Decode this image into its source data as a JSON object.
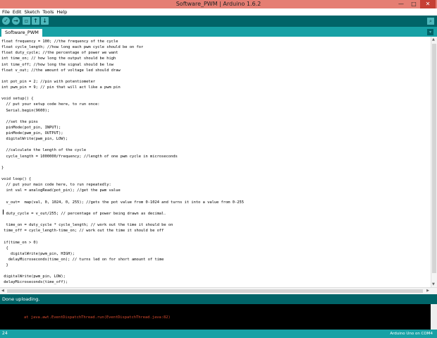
{
  "window": {
    "title": "Software_PWM | Arduino 1.6.2",
    "minimize": "—",
    "maximize": "□",
    "close": "✕"
  },
  "menu": [
    "File",
    "Edit",
    "Sketch",
    "Tools",
    "Help"
  ],
  "toolbar": {
    "verify_icon": "check-icon",
    "upload_icon": "arrow-right-icon",
    "new_icon": "new-file-icon",
    "open_icon": "arrow-up-icon",
    "save_icon": "arrow-down-icon",
    "serial_monitor_icon": "magnifier-icon"
  },
  "tabs": [
    {
      "label": "Software_PWM"
    }
  ],
  "code": [
    "float frequency = 100; //the frequency of the cycle",
    "float cycle_length; //how long each pwm cycle should be on for",
    "float duty_cycle; //the percentage of power we want",
    "int time_on; // how long the output should be high",
    "int time_off; //how long the signal should be low",
    "float v_out; //the amount of voltage led should draw",
    "",
    "int pot_pin = 2; //pin with potentiometer",
    "int pwm_pin = 9; // pin that will act like a pwm pin",
    "",
    "void setup() {",
    "  // put your setup code here, to run once:",
    "  Serial.begin(9600);",
    "",
    "  //set the pins",
    "  pinMode(pot_pin, INPUT);",
    "  pinMode(pwm_pin, OUTPUT);",
    "  digitalWrite(pwm_pin, LOW);",
    "",
    "  //calculate the length of the cycle",
    "  cycle_length = 1000000/frequency; //length of one pwm cycle in microseconds",
    "",
    "}",
    "",
    "void loop() {",
    "  // put your main code here, to run repeatedly:",
    "  int val = analogRead(pot_pin); //get the pwm value",
    "",
    "  v_out=  map(val, 0, 1024, 0, 255); //gets the pot value from 0-1024 and turns it into a value from 0-255",
    "",
    "  duty_cycle = v_out/255; // percentage of power being drawn as decimal.",
    "",
    "  time_on = duty_cycle * cycle_length; // work out the time it should be on",
    " time_off = cycle_length-time_on; // work out the time it should be off",
    "",
    " if(time_on > 0)",
    "  {",
    "    digitalWrite(pwm_pin, HIGH);",
    "   delayMicroseconds(time_on); // turns led on for short amount of time",
    "  }",
    "",
    " digitalWrite(pwm_pin, LOW);",
    " delayMicroseconds(time_off);"
  ],
  "status": {
    "message": "Done uploading."
  },
  "console": {
    "line": "at java.awt.EventDispatchThread.run(EventDispatchThread.java:82)"
  },
  "footer": {
    "line_number": "24",
    "board": "Arduino Uno on COM4"
  }
}
